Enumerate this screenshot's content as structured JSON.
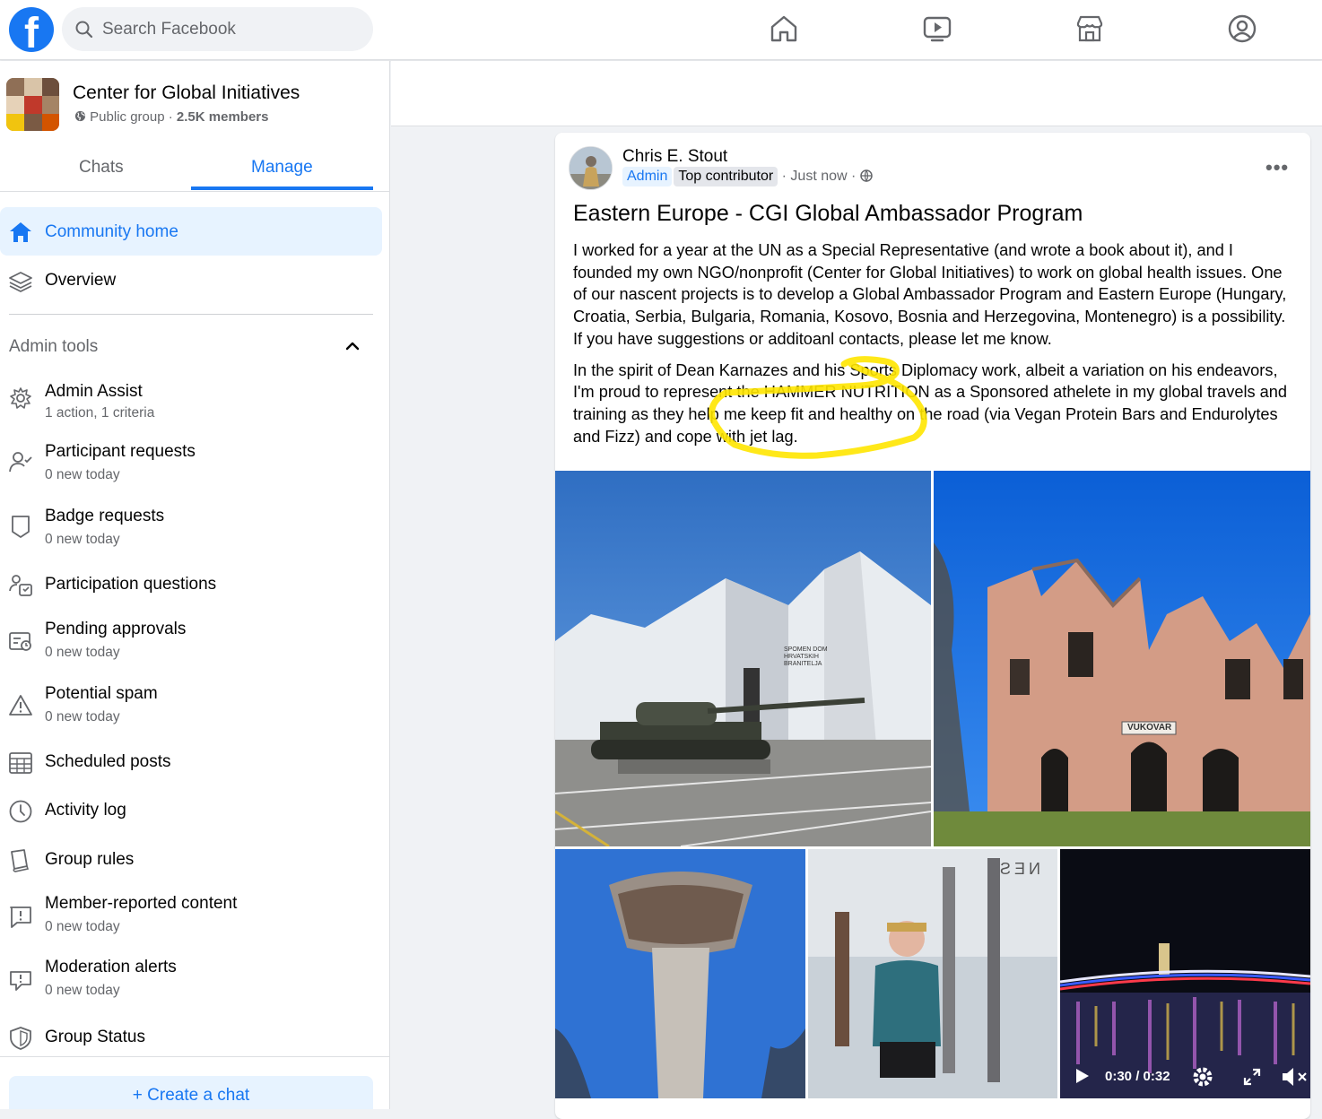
{
  "topbar": {
    "logo_letter": "f",
    "search_placeholder": "Search Facebook",
    "nav_icons": [
      "home-icon",
      "video-icon",
      "marketplace-icon",
      "groups-icon"
    ]
  },
  "group": {
    "name": "Center for Global Initiatives",
    "privacy": "Public group",
    "separator": " · ",
    "members": "2.5K members"
  },
  "tabs": {
    "chats": "Chats",
    "manage": "Manage"
  },
  "nav": {
    "community_home": "Community home",
    "overview": "Overview",
    "admin_tools": "Admin tools",
    "items": [
      {
        "label": "Admin Assist",
        "sub": "1 action, 1 criteria",
        "icon": "admin-assist-icon"
      },
      {
        "label": "Participant requests",
        "sub": "0 new today",
        "icon": "participant-requests-icon"
      },
      {
        "label": "Badge requests",
        "sub": "0 new today",
        "icon": "badge-icon"
      },
      {
        "label": "Participation questions",
        "sub": "",
        "icon": "questions-icon"
      },
      {
        "label": "Pending approvals",
        "sub": "0 new today",
        "icon": "pending-approvals-icon"
      },
      {
        "label": "Potential spam",
        "sub": "0 new today",
        "icon": "warning-icon"
      },
      {
        "label": "Scheduled posts",
        "sub": "",
        "icon": "calendar-icon"
      },
      {
        "label": "Activity log",
        "sub": "",
        "icon": "clock-icon"
      },
      {
        "label": "Group rules",
        "sub": "",
        "icon": "book-icon"
      },
      {
        "label": "Member-reported content",
        "sub": "0 new today",
        "icon": "report-icon"
      },
      {
        "label": "Moderation alerts",
        "sub": "0 new today",
        "icon": "alert-bubble-icon"
      },
      {
        "label": "Group Status",
        "sub": "",
        "icon": "shield-icon"
      }
    ],
    "create_chat": "Create a chat"
  },
  "post": {
    "author": "Chris E. Stout",
    "badge_admin": "Admin",
    "badge_top": "Top contributor",
    "time": " · Just now · ",
    "title": "Eastern Europe - CGI Global Ambassador Program",
    "para1": "I worked for a year at the UN as a Special Representative (and wrote a book about it), and I founded my own NGO/nonprofit (Center for Global Initiatives) to work on global health issues. One of our nascent projects is to develop a Global Ambassador Program and Eastern Europe (Hungary, Croatia, Serbia, Bulgaria, Romania, Kosovo, Bosnia and Herzegovina, Montenegro) is a possibility. If you have suggestions or additoanl contacts, please let me know.",
    "para2": "In the spirit of Dean Karnazes and his Sports Diplomacy work, albeit a variation on his endeavors, I'm proud to represent the HAMMER NUTRITION as a Sponsored athelete in my global travels and training as they help me keep fit and healthy on the road (via Vegan Protein Bars and Endurolytes and Fizz) and cope with jet lag.",
    "photo_sign_1": "SPOMEN DOM HRVATSKIH BRANITELJA",
    "photo_sign_2": "VUKOVAR",
    "gym_sign": "NES",
    "video_time": "0:30 / 0:32",
    "highlight_color": "#ffe500"
  }
}
